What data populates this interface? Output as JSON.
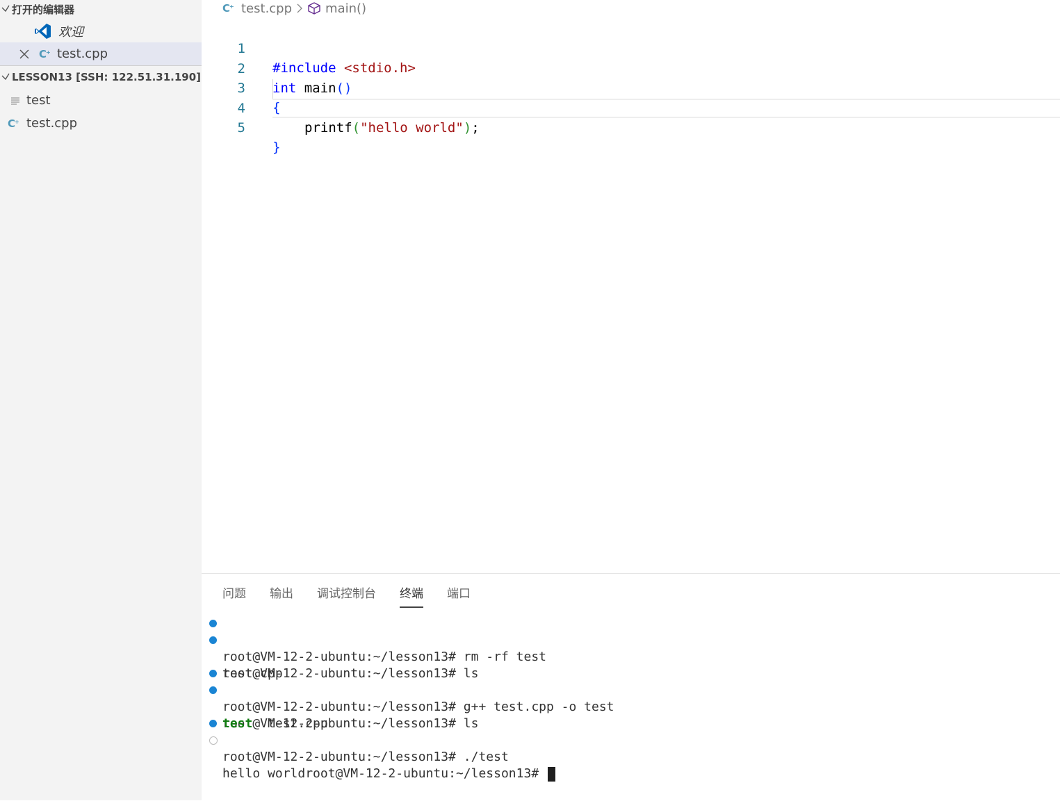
{
  "sidebar": {
    "open_editors_title": "打开的编辑器",
    "open_editors": [
      {
        "label": "欢迎"
      },
      {
        "label": "test.cpp"
      }
    ],
    "workspace_title": "LESSON13 [SSH: 122.51.31.190]",
    "files": [
      {
        "label": "test"
      },
      {
        "label": "test.cpp"
      }
    ]
  },
  "breadcrumb": {
    "file": "test.cpp",
    "symbol": "main()"
  },
  "editor": {
    "line_numbers": [
      "1",
      "2",
      "3",
      "4",
      "5"
    ],
    "lines": {
      "l1_pp": "#include ",
      "l1_inc": "<stdio.h>",
      "l2_kw": "int",
      "l2_name": " main",
      "l2_parens": "()",
      "l3": "{",
      "l4_fn": "printf",
      "l4_open": "(",
      "l4_str": "\"hello world\"",
      "l4_close": ")",
      "l4_semi": ";",
      "l5": "}"
    }
  },
  "panel": {
    "tabs": [
      "问题",
      "输出",
      "调试控制台",
      "终端",
      "端口"
    ],
    "active_tab": "终端",
    "terminal": {
      "l1": "root@VM-12-2-ubuntu:~/lesson13# rm -rf test",
      "l2": "root@VM-12-2-ubuntu:~/lesson13# ls",
      "l3": "test.cpp",
      "l4": "root@VM-12-2-ubuntu:~/lesson13# g++ test.cpp -o test",
      "l5": "root@VM-12-2-ubuntu:~/lesson13# ls",
      "l6_exec": "test",
      "l6_rest": "  test.cpp",
      "l7": "root@VM-12-2-ubuntu:~/lesson13# ./test",
      "l8": "hello worldroot@VM-12-2-ubuntu:~/lesson13# "
    }
  },
  "colors": {
    "accent": "#1a85d4",
    "vscode_blue": "#0066b8",
    "cpp_icon": "#519aba",
    "executable_green": "#107c10"
  }
}
